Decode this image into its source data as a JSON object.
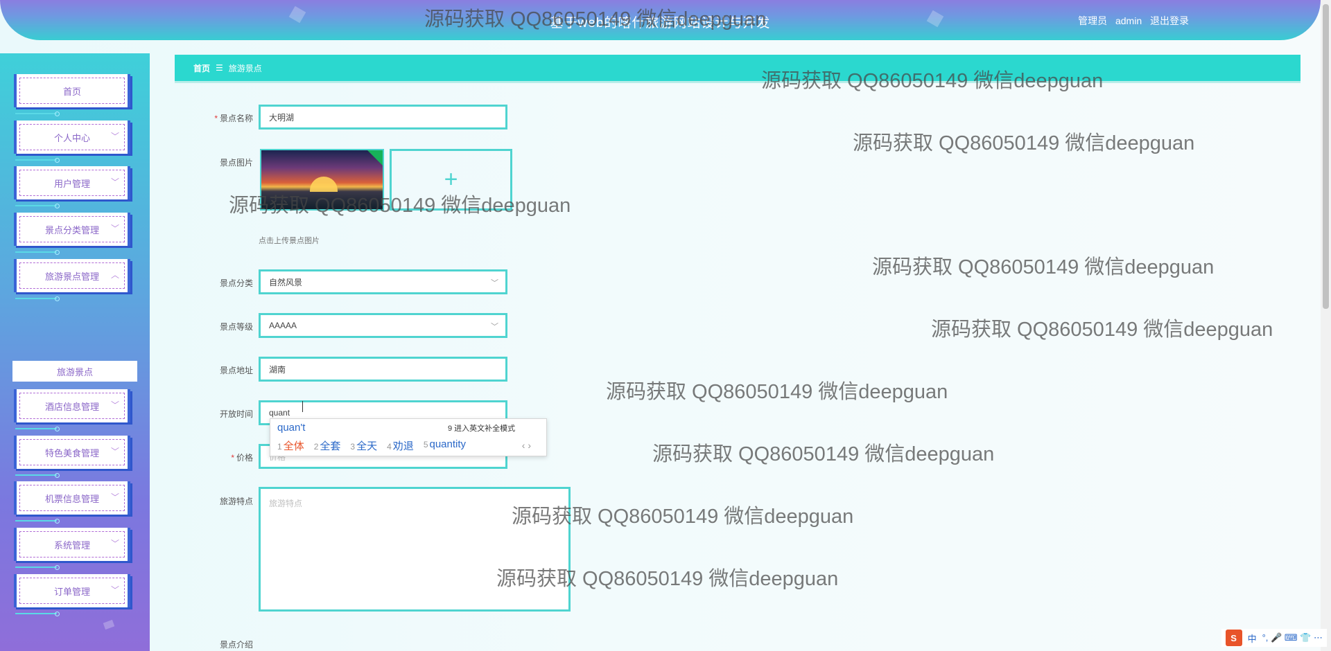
{
  "header": {
    "title": "基于web的喀什旅游网站设计与开发",
    "user_role": "管理员",
    "username": "admin",
    "logout": "退出登录"
  },
  "sidebar": {
    "items": [
      {
        "label": "首页"
      },
      {
        "label": "个人中心"
      },
      {
        "label": "用户管理"
      },
      {
        "label": "景点分类管理"
      },
      {
        "label": "旅游景点管理"
      },
      {
        "label": "酒店信息管理"
      },
      {
        "label": "特色美食管理"
      },
      {
        "label": "机票信息管理"
      },
      {
        "label": "系统管理"
      },
      {
        "label": "订单管理"
      }
    ],
    "submenu_active": "旅游景点"
  },
  "breadcrumb": {
    "home": "首页",
    "separator": "☰",
    "current": "旅游景点"
  },
  "form": {
    "name": {
      "label": "景点名称",
      "value": "大明湖"
    },
    "image": {
      "label": "景点图片",
      "hint": "点击上传景点图片",
      "upload_icon": "+"
    },
    "category": {
      "label": "景点分类",
      "value": "自然风景"
    },
    "level": {
      "label": "景点等级",
      "value": "AAAAA"
    },
    "address": {
      "label": "景点地址",
      "value": "湖南"
    },
    "open_time": {
      "label": "开放时间",
      "value": "quant"
    },
    "price": {
      "label": "价格",
      "placeholder": "价格"
    },
    "features": {
      "label": "旅游特点",
      "placeholder": "旅游特点"
    },
    "intro": {
      "label": "景点介绍"
    }
  },
  "ime": {
    "composition": "quan't",
    "mode_hint": "9 进入英文补全模式",
    "candidates": [
      {
        "n": "1",
        "text": "全体"
      },
      {
        "n": "2",
        "text": "全套"
      },
      {
        "n": "3",
        "text": "全天"
      },
      {
        "n": "4",
        "text": "劝退"
      },
      {
        "n": "5",
        "text": "quantity"
      }
    ],
    "arrows": "‹ ›"
  },
  "watermark": {
    "text": "源码获取 QQ86050149 微信deepguan"
  },
  "tray": {
    "logo": "S",
    "lang": "中",
    "symbols": "°, 🎤 ⌨ 👕 ⋯"
  }
}
